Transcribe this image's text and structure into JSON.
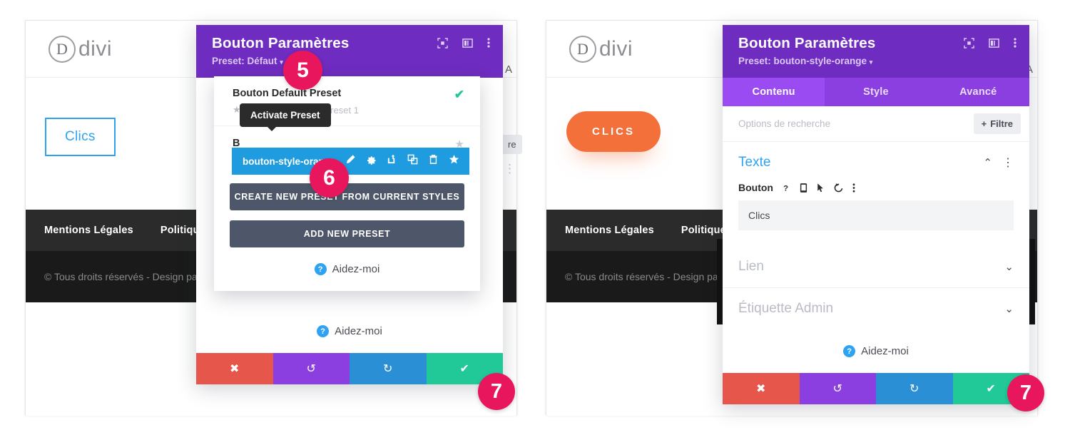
{
  "site": {
    "logo_letter": "D",
    "logo_word": "divi",
    "button_outline_label": "Clics",
    "button_orange_label": "CLICS",
    "footer_links": [
      "Mentions Légales",
      "Politique de"
    ],
    "footer_copyright": "© Tous droits réservés - Design pa"
  },
  "left_modal": {
    "title": "Bouton Paramètres",
    "preset_line": "Preset: Défaut",
    "preset_caret": "▾",
    "icons": {
      "fullscreen": "fullscreen-icon",
      "layout": "layout-split-icon",
      "more": "more-vertical-icon"
    },
    "dropdown": {
      "items": [
        {
          "name": "Bouton Default Preset",
          "subtitle": "Based On: Bouton Preset 1",
          "star": "★",
          "check": "✔"
        },
        {
          "name": "B",
          "star": "★"
        }
      ],
      "selected_preset": "bouton-style-orang",
      "selected_actions": [
        "edit-icon",
        "settings-icon",
        "export-icon",
        "duplicate-icon",
        "trash-icon",
        "star-icon"
      ],
      "tooltip": "Activate Preset",
      "create_button": "CREATE NEW PRESET FROM CURRENT STYLES",
      "add_button": "ADD NEW PRESET",
      "help_label": "Aidez-moi",
      "help_badge": "?"
    },
    "help_label": "Aidez-moi",
    "help_badge": "?",
    "actions": {
      "close": "✖",
      "undo": "↺",
      "redo": "↻",
      "save": "✔"
    },
    "ghost": {
      "tab_letter": "A",
      "filtre_partial": "re"
    }
  },
  "right_modal": {
    "title": "Bouton Paramètres",
    "preset_line": "Preset: bouton-style-orange",
    "preset_caret": "▾",
    "icons": {
      "fullscreen": "fullscreen-icon",
      "layout": "layout-split-icon",
      "more": "more-vertical-icon"
    },
    "tabs": [
      {
        "label": "Contenu",
        "active": true
      },
      {
        "label": "Style",
        "active": false
      },
      {
        "label": "Avancé",
        "active": false
      }
    ],
    "search_placeholder": "Options de recherche",
    "filter_button": "Filtre",
    "filter_plus": "+",
    "sections": [
      {
        "label": "Texte",
        "state": "open",
        "chevron": "⌃",
        "more": "⋮"
      },
      {
        "label": "Lien",
        "state": "closed",
        "chevron": "⌄"
      },
      {
        "label": "Étiquette Admin",
        "state": "closed",
        "chevron": "⌄"
      }
    ],
    "field": {
      "label": "Bouton",
      "value": "Clics",
      "icons": [
        "help-icon",
        "mobile-icon",
        "cursor-icon",
        "reset-icon",
        "more-vertical-icon"
      ]
    },
    "help_label": "Aidez-moi",
    "help_badge": "?",
    "actions": {
      "close": "✖",
      "undo": "↺",
      "redo": "↻",
      "save": "✔"
    },
    "ghost": {
      "tab_letter": "A"
    }
  },
  "badges": {
    "five": "5",
    "six": "6",
    "seven_left": "7",
    "seven_right": "7"
  },
  "colors": {
    "purple_header": "#6F2CC0",
    "purple_tabs": "#8B3FE0",
    "purple_active": "#9B4BF2",
    "blue_selected": "#1F9CE0",
    "pink_badge": "#E8175D",
    "orange_button": "#F4703A",
    "green_save": "#20C997",
    "red_close": "#E6564A",
    "blue_redo": "#2A8FD4",
    "slate_button": "#4E5769"
  }
}
